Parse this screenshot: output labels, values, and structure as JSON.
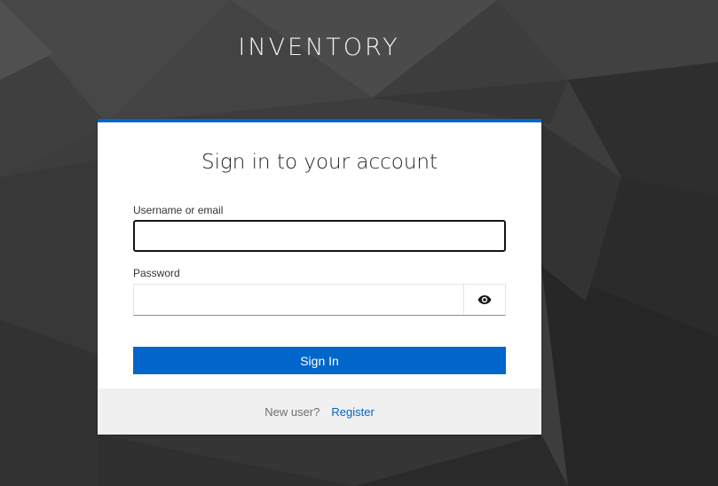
{
  "realm": {
    "title": "INVENTORY"
  },
  "login": {
    "heading": "Sign in to your account",
    "username_label": "Username or email",
    "username_value": "",
    "password_label": "Password",
    "password_value": "",
    "show_password_icon": "eye-icon",
    "submit_label": "Sign In"
  },
  "registration": {
    "prompt": "New user?",
    "link_label": "Register"
  },
  "colors": {
    "accent": "#0066cc",
    "background": "#3b3b3b",
    "footer_bg": "#f0f0f0"
  }
}
